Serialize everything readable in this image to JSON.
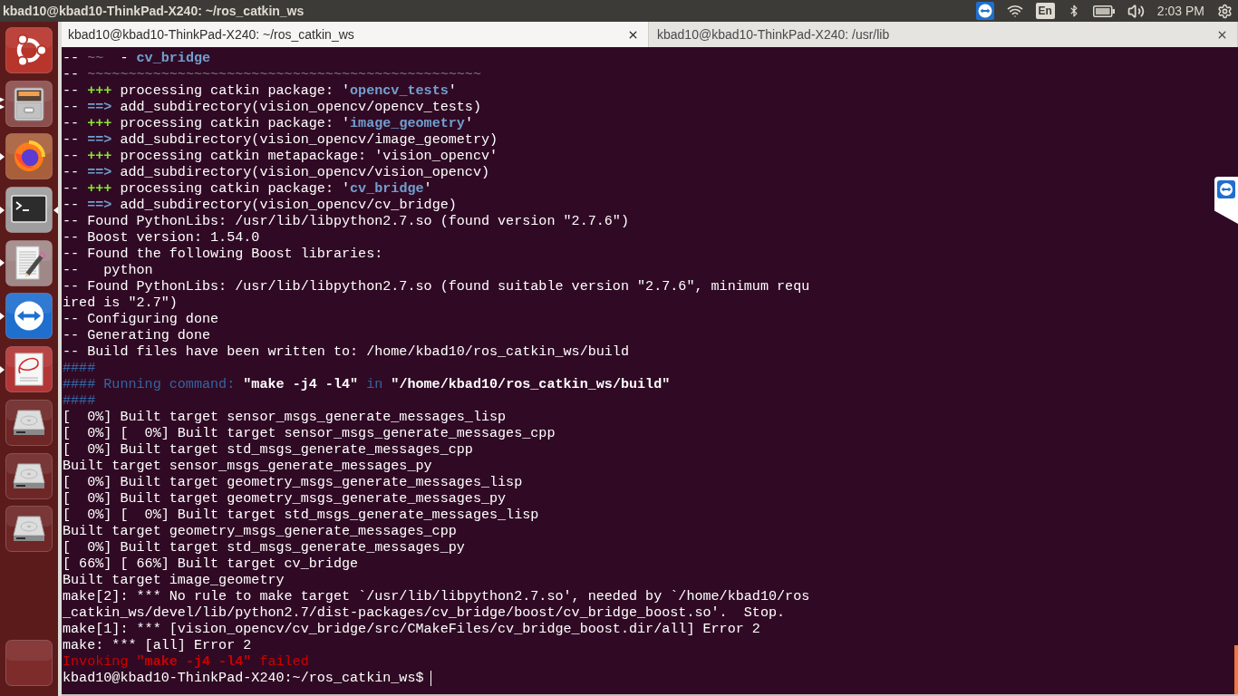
{
  "top_bar": {
    "title": "kbad10@kbad10-ThinkPad-X240: ~/ros_catkin_ws",
    "keyboard_layout": "En",
    "clock": "2:03 PM"
  },
  "launcher": {
    "items": [
      {
        "kind": "dash",
        "running": false,
        "several_windows": false,
        "focused": false
      },
      {
        "kind": "files",
        "running": true,
        "several_windows": true,
        "focused": false
      },
      {
        "kind": "browser",
        "running": true,
        "several_windows": false,
        "focused": false
      },
      {
        "kind": "terminal",
        "running": true,
        "several_windows": false,
        "focused": true
      },
      {
        "kind": "editor",
        "running": true,
        "several_windows": false,
        "focused": false
      },
      {
        "kind": "remote",
        "running": true,
        "several_windows": false,
        "focused": false
      },
      {
        "kind": "document",
        "running": true,
        "several_windows": false,
        "focused": false
      },
      {
        "kind": "drive",
        "running": false,
        "several_windows": false,
        "focused": false
      },
      {
        "kind": "drive",
        "running": false,
        "several_windows": false,
        "focused": false
      },
      {
        "kind": "drive",
        "running": false,
        "several_windows": false,
        "focused": false
      }
    ],
    "bottom_items": [
      {
        "kind": "blank",
        "running": false,
        "several_windows": false,
        "focused": false
      }
    ]
  },
  "tabs": [
    {
      "title": "kbad10@kbad10-ThinkPad-X240: ~/ros_catkin_ws",
      "selected": true
    },
    {
      "title": "kbad10@kbad10-ThinkPad-X240: /usr/lib",
      "selected": false
    }
  ],
  "terminal": {
    "cursor": true,
    "lines": [
      {
        "segments": [
          {
            "kind": "plain",
            "text": "-- "
          },
          {
            "kind": "dim",
            "text": "~~"
          },
          {
            "kind": "plain",
            "text": "  - "
          },
          {
            "kind": "accent",
            "text": "cv_bridge"
          }
        ]
      },
      {
        "segments": [
          {
            "kind": "plain",
            "text": "-- "
          },
          {
            "kind": "dim",
            "text": "~~~~~~~~~~~~~~~~~~~~~~~~~~~~~~~~~~~~~~~~~~~~~~~~"
          }
        ]
      },
      {
        "segments": [
          {
            "kind": "plain",
            "text": "-- "
          },
          {
            "kind": "added",
            "text": "+++"
          },
          {
            "kind": "plain",
            "text": " processing catkin package: '"
          },
          {
            "kind": "accent",
            "text": "opencv_tests"
          },
          {
            "kind": "plain",
            "text": "'"
          }
        ]
      },
      {
        "segments": [
          {
            "kind": "plain",
            "text": "-- "
          },
          {
            "kind": "accent",
            "text": "==>"
          },
          {
            "kind": "plain",
            "text": " add_subdirectory(vision_opencv/opencv_tests)"
          }
        ]
      },
      {
        "segments": [
          {
            "kind": "plain",
            "text": "-- "
          },
          {
            "kind": "added",
            "text": "+++"
          },
          {
            "kind": "plain",
            "text": " processing catkin package: '"
          },
          {
            "kind": "accent",
            "text": "image_geometry"
          },
          {
            "kind": "plain",
            "text": "'"
          }
        ]
      },
      {
        "segments": [
          {
            "kind": "plain",
            "text": "-- "
          },
          {
            "kind": "accent",
            "text": "==>"
          },
          {
            "kind": "plain",
            "text": " add_subdirectory(vision_opencv/image_geometry)"
          }
        ]
      },
      {
        "segments": [
          {
            "kind": "plain",
            "text": "-- "
          },
          {
            "kind": "added",
            "text": "+++"
          },
          {
            "kind": "plain",
            "text": " processing catkin metapackage: 'vision_opencv'"
          }
        ]
      },
      {
        "segments": [
          {
            "kind": "plain",
            "text": "-- "
          },
          {
            "kind": "accent",
            "text": "==>"
          },
          {
            "kind": "plain",
            "text": " add_subdirectory(vision_opencv/vision_opencv)"
          }
        ]
      },
      {
        "segments": [
          {
            "kind": "plain",
            "text": "-- "
          },
          {
            "kind": "added",
            "text": "+++"
          },
          {
            "kind": "plain",
            "text": " processing catkin package: '"
          },
          {
            "kind": "accent",
            "text": "cv_bridge"
          },
          {
            "kind": "plain",
            "text": "'"
          }
        ]
      },
      {
        "segments": [
          {
            "kind": "plain",
            "text": "-- "
          },
          {
            "kind": "accent",
            "text": "==>"
          },
          {
            "kind": "plain",
            "text": " add_subdirectory(vision_opencv/cv_bridge)"
          }
        ]
      },
      {
        "segments": [
          {
            "kind": "plain",
            "text": "-- Found PythonLibs: /usr/lib/libpython2.7.so (found version \"2.7.6\")"
          }
        ]
      },
      {
        "segments": [
          {
            "kind": "plain",
            "text": "-- Boost version: 1.54.0"
          }
        ]
      },
      {
        "segments": [
          {
            "kind": "plain",
            "text": "-- Found the following Boost libraries:"
          }
        ]
      },
      {
        "segments": [
          {
            "kind": "plain",
            "text": "--   python"
          }
        ]
      },
      {
        "segments": [
          {
            "kind": "plain",
            "text": "-- Found PythonLibs: /usr/lib/libpython2.7.so (found suitable version \"2.7.6\", minimum requ"
          }
        ]
      },
      {
        "segments": [
          {
            "kind": "plain",
            "text": "ired is \"2.7\")"
          }
        ]
      },
      {
        "segments": [
          {
            "kind": "plain",
            "text": "-- Configuring done"
          }
        ]
      },
      {
        "segments": [
          {
            "kind": "plain",
            "text": "-- Generating done"
          }
        ]
      },
      {
        "segments": [
          {
            "kind": "plain",
            "text": "-- Build files have been written to: /home/kbad10/ros_catkin_ws/build"
          }
        ]
      },
      {
        "segments": [
          {
            "kind": "header",
            "text": "####"
          }
        ]
      },
      {
        "segments": [
          {
            "kind": "header",
            "text": "#### Running command: "
          },
          {
            "kind": "strong",
            "text": "\"make -j4 -l4\""
          },
          {
            "kind": "header",
            "text": " in "
          },
          {
            "kind": "strong",
            "text": "\"/home/kbad10/ros_catkin_ws/build\""
          }
        ]
      },
      {
        "segments": [
          {
            "kind": "header",
            "text": "####"
          }
        ]
      },
      {
        "segments": [
          {
            "kind": "plain",
            "text": "[  0%] Built target sensor_msgs_generate_messages_lisp"
          }
        ]
      },
      {
        "segments": [
          {
            "kind": "plain",
            "text": "[  0%] [  0%] Built target sensor_msgs_generate_messages_cpp"
          }
        ]
      },
      {
        "segments": [
          {
            "kind": "plain",
            "text": "[  0%] Built target std_msgs_generate_messages_cpp"
          }
        ]
      },
      {
        "segments": [
          {
            "kind": "plain",
            "text": "Built target sensor_msgs_generate_messages_py"
          }
        ]
      },
      {
        "segments": [
          {
            "kind": "plain",
            "text": "[  0%] Built target geometry_msgs_generate_messages_lisp"
          }
        ]
      },
      {
        "segments": [
          {
            "kind": "plain",
            "text": "[  0%] Built target geometry_msgs_generate_messages_py"
          }
        ]
      },
      {
        "segments": [
          {
            "kind": "plain",
            "text": "[  0%] [  0%] Built target std_msgs_generate_messages_lisp"
          }
        ]
      },
      {
        "segments": [
          {
            "kind": "plain",
            "text": "Built target geometry_msgs_generate_messages_cpp"
          }
        ]
      },
      {
        "segments": [
          {
            "kind": "plain",
            "text": "[  0%] Built target std_msgs_generate_messages_py"
          }
        ]
      },
      {
        "segments": [
          {
            "kind": "plain",
            "text": "[ 66%] [ 66%] Built target cv_bridge"
          }
        ]
      },
      {
        "segments": [
          {
            "kind": "plain",
            "text": "Built target image_geometry"
          }
        ]
      },
      {
        "segments": [
          {
            "kind": "plain",
            "text": "make[2]: *** No rule to make target `/usr/lib/libpython2.7.so', needed by `/home/kbad10/ros"
          }
        ]
      },
      {
        "segments": [
          {
            "kind": "plain",
            "text": "_catkin_ws/devel/lib/python2.7/dist-packages/cv_bridge/boost/cv_bridge_boost.so'.  Stop."
          }
        ]
      },
      {
        "segments": [
          {
            "kind": "plain",
            "text": "make[1]: *** [vision_opencv/cv_bridge/src/CMakeFiles/cv_bridge_boost.dir/all] Error 2"
          }
        ]
      },
      {
        "segments": [
          {
            "kind": "plain",
            "text": "make: *** [all] Error 2"
          }
        ]
      },
      {
        "segments": [
          {
            "kind": "error",
            "text": "Invoking "
          },
          {
            "kind": "error_strong",
            "text": "\"make -j4 -l4\""
          },
          {
            "kind": "error",
            "text": " failed"
          }
        ]
      },
      {
        "segments": [
          {
            "kind": "plain",
            "text": "kbad10@kbad10-ThinkPad-X240:~/ros_catkin_ws$"
          }
        ]
      }
    ]
  }
}
